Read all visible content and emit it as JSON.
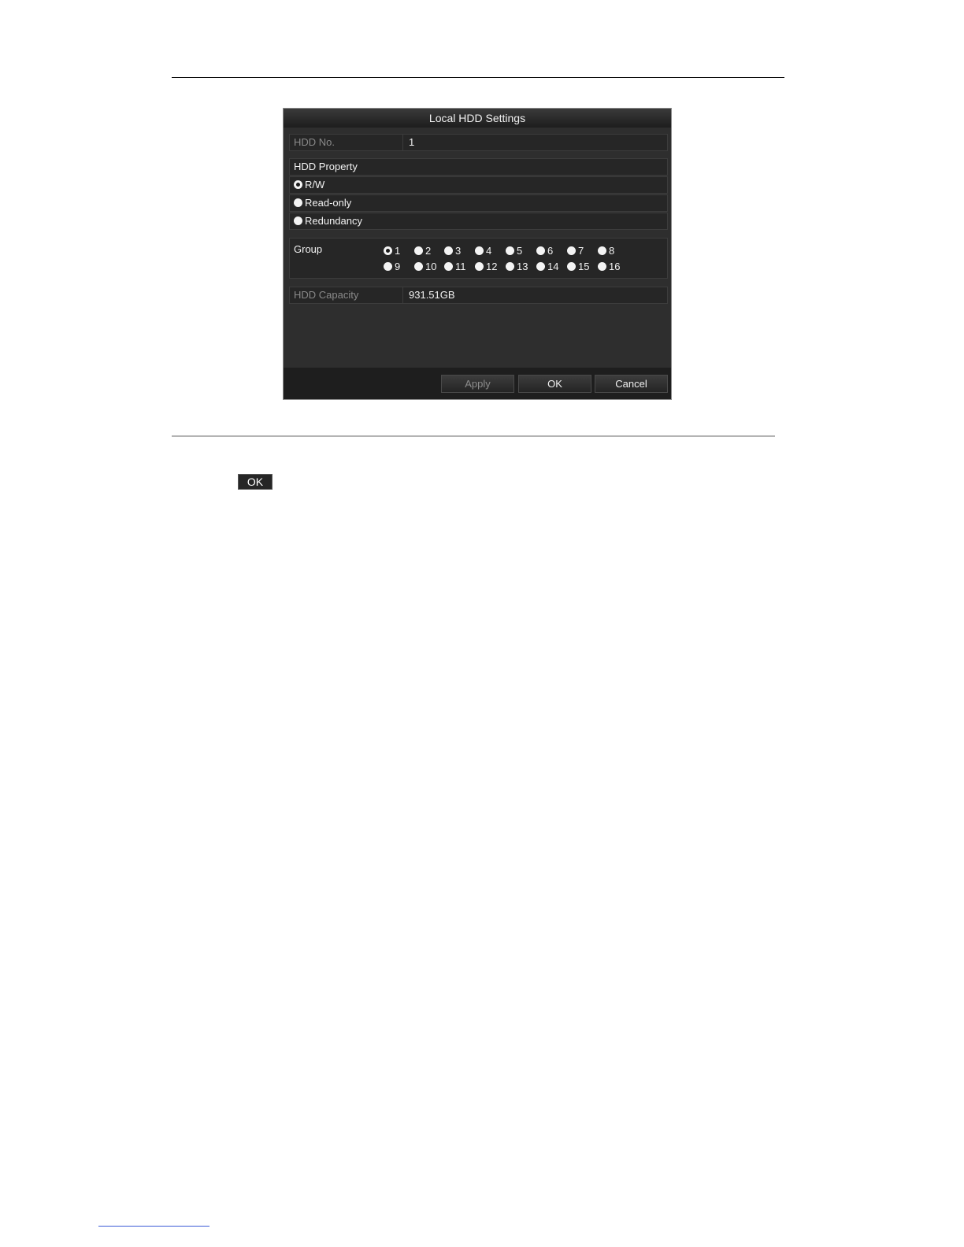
{
  "dialog": {
    "title": "Local HDD Settings",
    "hdd_no": {
      "label": "HDD No.",
      "value": "1"
    },
    "hdd_property": {
      "label": "HDD Property",
      "options": [
        {
          "label": "R/W",
          "checked": true
        },
        {
          "label": "Read-only",
          "checked": false
        },
        {
          "label": "Redundancy",
          "checked": false
        }
      ]
    },
    "group": {
      "label": "Group",
      "options": [
        "1",
        "2",
        "3",
        "4",
        "5",
        "6",
        "7",
        "8",
        "9",
        "10",
        "11",
        "12",
        "13",
        "14",
        "15",
        "16"
      ],
      "selected": "1"
    },
    "hdd_capacity": {
      "label": "HDD Capacity",
      "value": "931.51GB"
    },
    "buttons": {
      "apply": "Apply",
      "ok": "OK",
      "cancel": "Cancel"
    }
  },
  "inline_button": {
    "label": "OK"
  }
}
